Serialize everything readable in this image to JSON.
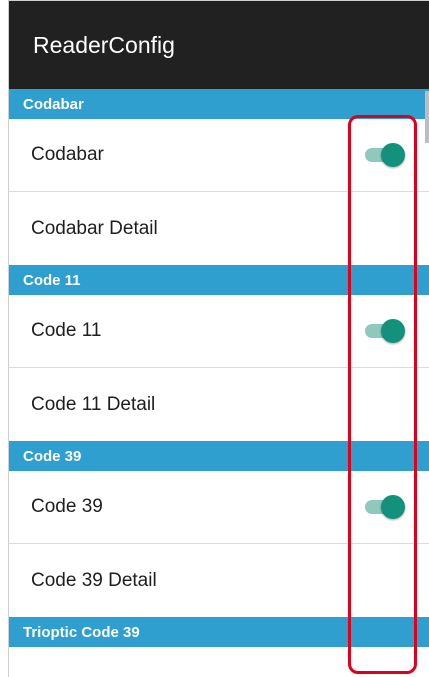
{
  "appbar": {
    "title": "ReaderConfig"
  },
  "sections": [
    {
      "header": "Codabar",
      "rows": [
        {
          "label": "Codabar",
          "toggle": true,
          "on": true
        },
        {
          "label": "Codabar Detail",
          "toggle": false
        }
      ]
    },
    {
      "header": "Code 11",
      "rows": [
        {
          "label": "Code 11",
          "toggle": true,
          "on": true
        },
        {
          "label": "Code 11 Detail",
          "toggle": false
        }
      ]
    },
    {
      "header": "Code 39",
      "rows": [
        {
          "label": "Code 39",
          "toggle": true,
          "on": true
        },
        {
          "label": "Code 39 Detail",
          "toggle": false
        }
      ]
    },
    {
      "header": "Trioptic Code 39",
      "rows": []
    }
  ],
  "colors": {
    "appbar": "#212121",
    "section_header": "#2e9fcf",
    "switch_thumb_on": "#13917c",
    "switch_track_on": "#8fc9bd",
    "highlight_box": "#e0001b"
  }
}
